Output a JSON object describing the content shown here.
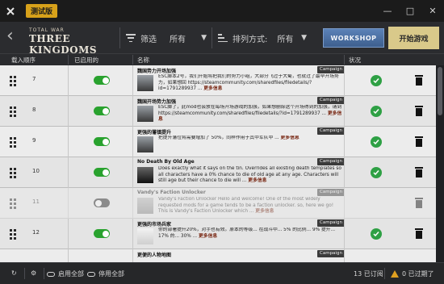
{
  "titlebar": {
    "badge": "测试版",
    "controls": [
      "—",
      "□",
      "✕"
    ]
  },
  "header": {
    "logo_small": "TOTAL WAR",
    "logo_big": "THREE KINGDOMS",
    "filter_label": "筛选",
    "filter_value": "所有",
    "sort_label": "排列方式:",
    "sort_value": "所有",
    "workshop_label": "WORKSHOP",
    "play_label": "开始游戏"
  },
  "columns": {
    "order": "载入顺序",
    "enabled": "已启用的",
    "name": "名称",
    "status": "状况"
  },
  "rows": [
    {
      "order": "7",
      "enabled": true,
      "title": "魏国势力开场加强",
      "tag": "Campaign",
      "desc": "ESC脚本2号，我们开始将把我们的势力小组，大部分飞过于大蜀，也就过了最早开场势力，如果想回 https://steamcommunity.com/sharedfiles/filedetails/?id=1791289937 ... ",
      "more": "更多信息"
    },
    {
      "order": "8",
      "enabled": true,
      "title": "魏国开场势力加强",
      "tag": "Campaign",
      "desc": "ESC脚了，此mod也会放在每场开场游戏的加强，如果想删除这个开场得到的加强，请到 https://steamcommunity.com/sharedfiles/filedetails/?id=1791289937 ... ",
      "more": "更多信息"
    },
    {
      "order": "9",
      "enabled": true,
      "title": "更强的藩镇提升",
      "tag": "Campaign",
      "desc": "把提升藩位将需要增加了 50%，同样作用于其中军队中 ... ",
      "more": "更多信息"
    },
    {
      "order": "10",
      "enabled": true,
      "title": "No Death By Old Age",
      "tag": "Campaign",
      "desc": "Does exactly what it says on the tin.  Overrides all existing death templates so all characters have a 0% chance to die of old age at any age. Characters will still age but their chance to die will ... ",
      "more": "更多信息"
    },
    {
      "order": "11",
      "enabled": false,
      "title": "Vandy's Faction Unlocker",
      "tag": "Campaign",
      "desc": "Vandy's Faction Unlocker Hello and welcome! One of the most widely requested mods for a game tends to be a faction unlocker. so, here we go! This is Vandy's Faction Unlocker which ... ",
      "more": "更多信息"
    },
    {
      "order": "12",
      "enabled": true,
      "title": "更强的市场兵家",
      "tag": "Campaign",
      "desc": "你的部署提升20%，对手也有效。原本的等级... 在战斗中... 5% 的比例... 9% 提升... 17% 的... 30% ... ",
      "more": "更多信息"
    },
    {
      "order": "13",
      "enabled": true,
      "title": "更便的人物地图",
      "tag": "Campaign",
      "desc": "",
      "more": ""
    }
  ],
  "footer": {
    "refresh": "↻",
    "settings": "⚙",
    "enable_all": "启用全部",
    "disable_all": "停用全部",
    "subscribed": "13 已订阅",
    "outdated": "0 已过期了"
  },
  "colors": {
    "accent_green": "#29a22e",
    "status_green": "#2ea044",
    "play_bg": "#d9c98a",
    "workshop_bg": "#4f72a6",
    "warn": "#e0a020"
  }
}
